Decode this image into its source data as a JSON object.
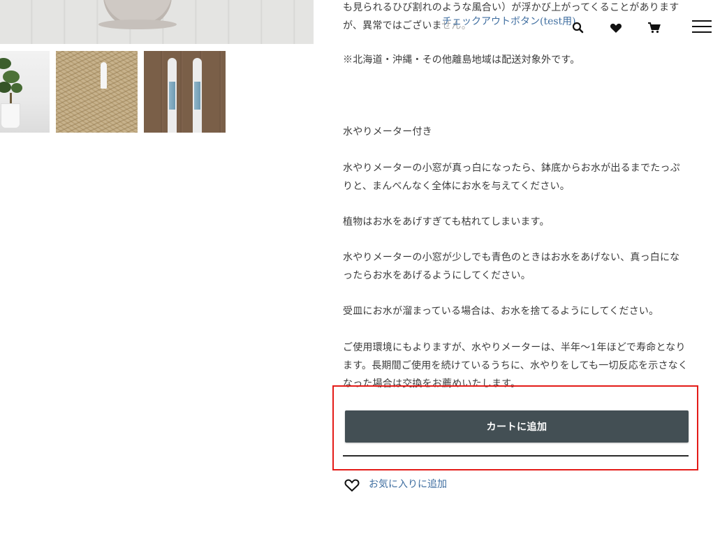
{
  "header": {
    "cta_link": "チェックアウトボタン(test用)",
    "icons": [
      "search-icon",
      "heart-icon",
      "cart-icon",
      "hamburger-menu-icon"
    ]
  },
  "gallery": {
    "main_image": "product-photo",
    "thumbnails": [
      "thumbnail-plant-pot",
      "thumbnail-meter-in-soil",
      "thumbnail-water-meters"
    ]
  },
  "description": {
    "lines": [
      "も見られるひび割れのような風合い）が浮かび上がってくることがありますが、異常ではございません。",
      "※北海道・沖縄・その他離島地域は配送対象外です。",
      "水やりメーター付き",
      "水やりメーターの小窓が真っ白になったら、鉢底からお水が出るまでたっぷりと、まんべんなく全体にお水を与えてください。",
      "植物はお水をあげすぎても枯れてしまいます。",
      "水やりメーターの小窓が少しでも青色のときはお水をあげない、真っ白になったらお水をあげるようにしてください。",
      "受皿にお水が溜まっている場合は、お水を捨てるようにしてください。",
      "ご使用環境にもよりますが、水やりメーターは、半年〜1年ほどで寿命となります。長期間ご使用を続けているうちに、水やりをしても一切反応を示さなくなった場合は交換をお薦めいたします。"
    ]
  },
  "cart": {
    "add_to_cart_label": "カートに追加",
    "favorite_label": "お気に入りに追加"
  },
  "colors": {
    "button_bg": "#434f54",
    "link": "#3f6ea0",
    "highlight_border": "#e41b17"
  }
}
